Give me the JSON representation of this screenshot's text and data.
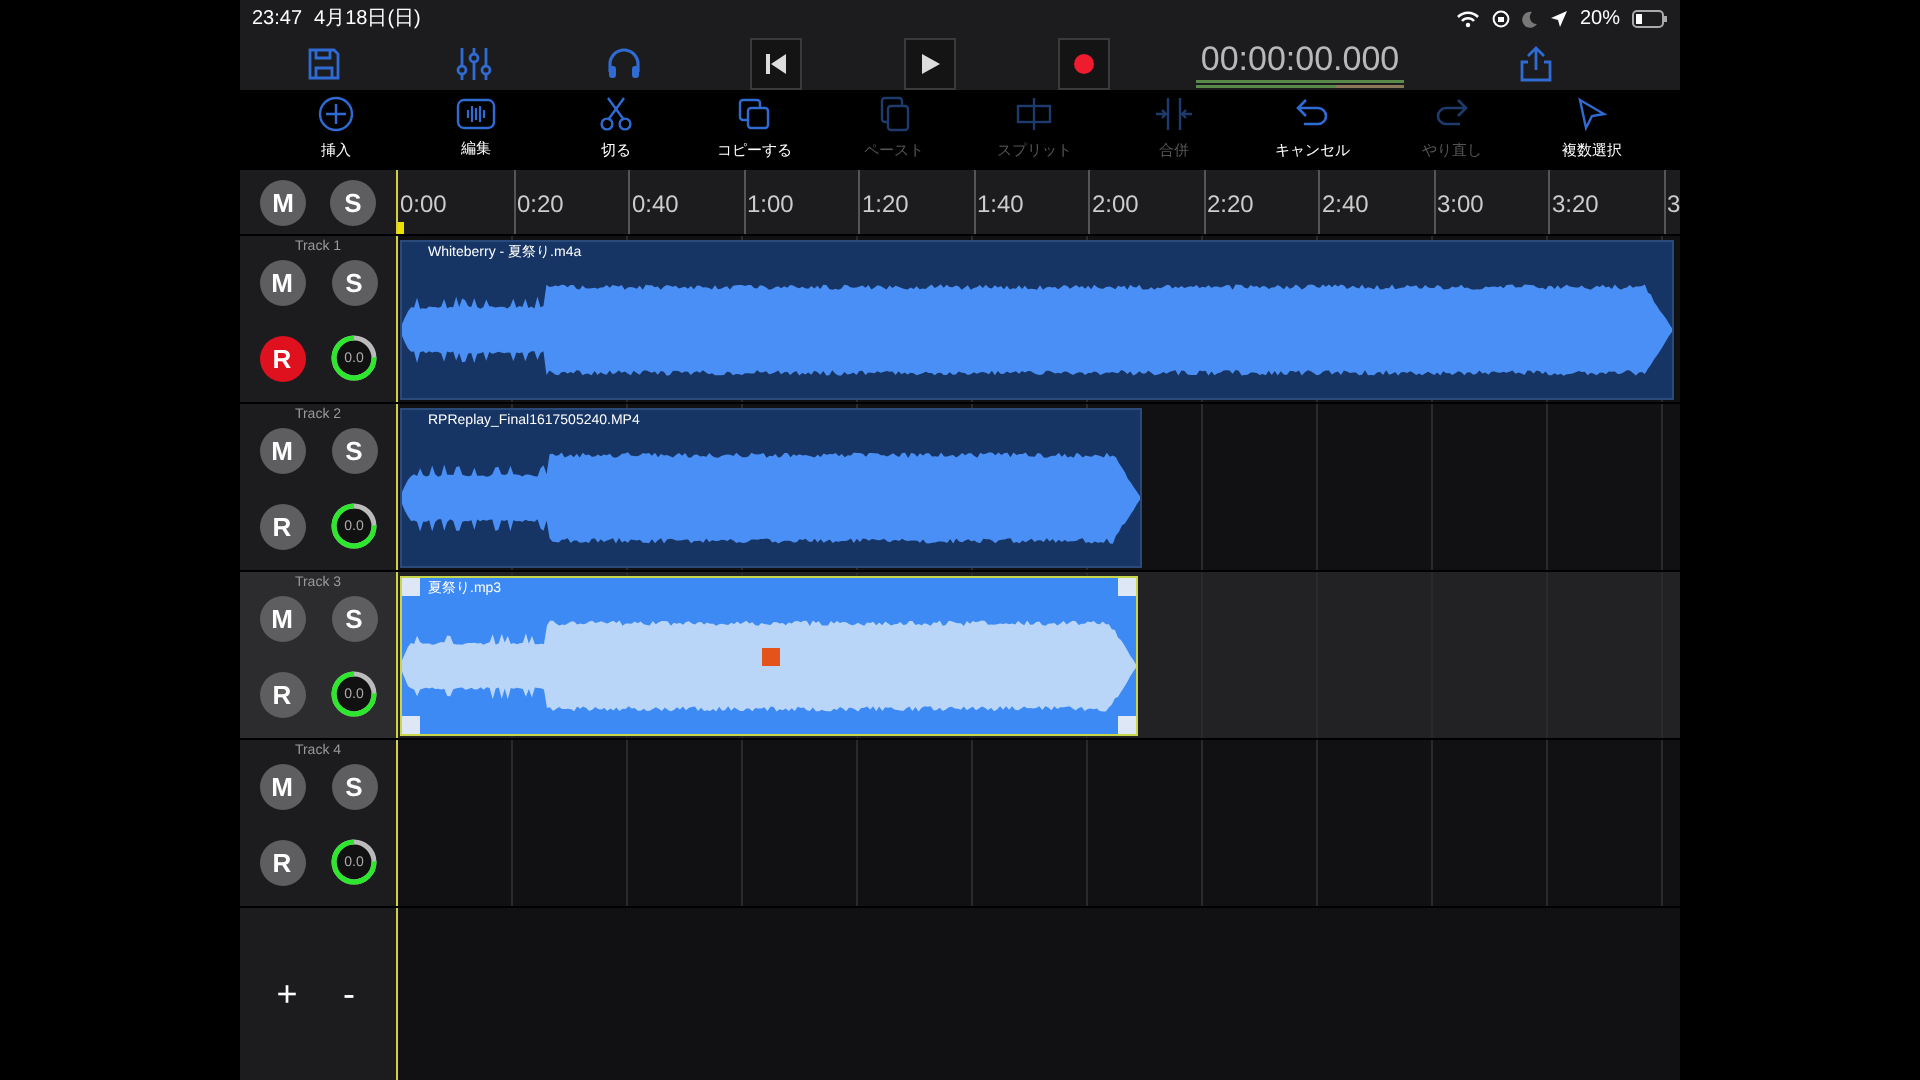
{
  "status_bar": {
    "time": "23:47",
    "date": "4月18日(日)",
    "battery": "20%"
  },
  "toolbar": [
    {
      "kind": "save"
    },
    {
      "kind": "mixer"
    },
    {
      "kind": "headphones"
    },
    {
      "kind": "previous"
    },
    {
      "kind": "play"
    },
    {
      "kind": "record"
    },
    {
      "kind": "timecode",
      "text": "00:00:00.000"
    },
    {
      "kind": "share"
    }
  ],
  "edit_toolbar": [
    {
      "kind": "insert",
      "label": "挿入",
      "disabled": false
    },
    {
      "kind": "edit",
      "label": "編集",
      "disabled": false
    },
    {
      "kind": "cut",
      "label": "切る",
      "disabled": false
    },
    {
      "kind": "copy",
      "label": "コピーする",
      "disabled": false
    },
    {
      "kind": "paste",
      "label": "ペースト",
      "disabled": true
    },
    {
      "kind": "split",
      "label": "スプリット",
      "disabled": true
    },
    {
      "kind": "merge",
      "label": "合併",
      "disabled": true
    },
    {
      "kind": "undo",
      "label": "キャンセル",
      "disabled": false
    },
    {
      "kind": "redo",
      "label": "やり直し",
      "disabled": true
    },
    {
      "kind": "select",
      "label": "複数選択",
      "disabled": false
    }
  ],
  "master": {
    "mute": "M",
    "solo": "S"
  },
  "ruler": {
    "ticks": [
      "0:00",
      "0:20",
      "0:40",
      "1:00",
      "1:20",
      "1:40",
      "2:00",
      "2:20",
      "2:40",
      "3:00",
      "3:20",
      "3"
    ]
  },
  "tracks": [
    {
      "name": "Track 1",
      "mute": "M",
      "solo": "S",
      "record": "R",
      "armed": true,
      "selected": false,
      "knob": {
        "value": "0.0",
        "level": 0.75
      },
      "clips": [
        {
          "name": "Whiteberry - 夏祭り.m4a",
          "selected": false
        }
      ]
    },
    {
      "name": "Track 2",
      "mute": "M",
      "solo": "S",
      "record": "R",
      "armed": false,
      "selected": false,
      "knob": {
        "value": "0.0",
        "level": 0.75
      },
      "clips": [
        {
          "name": "RPReplay_Final1617505240.MP4",
          "selected": false
        }
      ]
    },
    {
      "name": "Track 3",
      "mute": "M",
      "solo": "S",
      "record": "R",
      "armed": false,
      "selected": true,
      "knob": {
        "value": "0.0",
        "level": 0.75
      },
      "clips": [
        {
          "name": "夏祭り.mp3",
          "selected": true
        }
      ]
    },
    {
      "name": "Track 4",
      "mute": "M",
      "solo": "S",
      "record": "R",
      "armed": false,
      "selected": false,
      "knob": {
        "value": "0.0",
        "level": 0.75
      }
    }
  ],
  "footer": {
    "add": "+",
    "remove": "-"
  }
}
